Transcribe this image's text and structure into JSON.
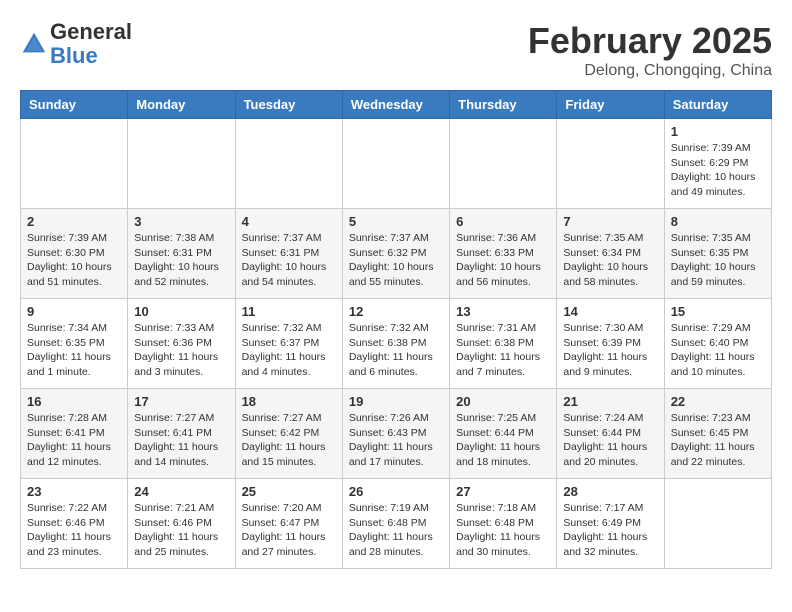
{
  "header": {
    "logo_line1": "General",
    "logo_line2": "Blue",
    "month": "February 2025",
    "location": "Delong, Chongqing, China"
  },
  "weekdays": [
    "Sunday",
    "Monday",
    "Tuesday",
    "Wednesday",
    "Thursday",
    "Friday",
    "Saturday"
  ],
  "weeks": [
    [
      {
        "day": "",
        "info": ""
      },
      {
        "day": "",
        "info": ""
      },
      {
        "day": "",
        "info": ""
      },
      {
        "day": "",
        "info": ""
      },
      {
        "day": "",
        "info": ""
      },
      {
        "day": "",
        "info": ""
      },
      {
        "day": "1",
        "info": "Sunrise: 7:39 AM\nSunset: 6:29 PM\nDaylight: 10 hours\nand 49 minutes."
      }
    ],
    [
      {
        "day": "2",
        "info": "Sunrise: 7:39 AM\nSunset: 6:30 PM\nDaylight: 10 hours\nand 51 minutes."
      },
      {
        "day": "3",
        "info": "Sunrise: 7:38 AM\nSunset: 6:31 PM\nDaylight: 10 hours\nand 52 minutes."
      },
      {
        "day": "4",
        "info": "Sunrise: 7:37 AM\nSunset: 6:31 PM\nDaylight: 10 hours\nand 54 minutes."
      },
      {
        "day": "5",
        "info": "Sunrise: 7:37 AM\nSunset: 6:32 PM\nDaylight: 10 hours\nand 55 minutes."
      },
      {
        "day": "6",
        "info": "Sunrise: 7:36 AM\nSunset: 6:33 PM\nDaylight: 10 hours\nand 56 minutes."
      },
      {
        "day": "7",
        "info": "Sunrise: 7:35 AM\nSunset: 6:34 PM\nDaylight: 10 hours\nand 58 minutes."
      },
      {
        "day": "8",
        "info": "Sunrise: 7:35 AM\nSunset: 6:35 PM\nDaylight: 10 hours\nand 59 minutes."
      }
    ],
    [
      {
        "day": "9",
        "info": "Sunrise: 7:34 AM\nSunset: 6:35 PM\nDaylight: 11 hours\nand 1 minute."
      },
      {
        "day": "10",
        "info": "Sunrise: 7:33 AM\nSunset: 6:36 PM\nDaylight: 11 hours\nand 3 minutes."
      },
      {
        "day": "11",
        "info": "Sunrise: 7:32 AM\nSunset: 6:37 PM\nDaylight: 11 hours\nand 4 minutes."
      },
      {
        "day": "12",
        "info": "Sunrise: 7:32 AM\nSunset: 6:38 PM\nDaylight: 11 hours\nand 6 minutes."
      },
      {
        "day": "13",
        "info": "Sunrise: 7:31 AM\nSunset: 6:38 PM\nDaylight: 11 hours\nand 7 minutes."
      },
      {
        "day": "14",
        "info": "Sunrise: 7:30 AM\nSunset: 6:39 PM\nDaylight: 11 hours\nand 9 minutes."
      },
      {
        "day": "15",
        "info": "Sunrise: 7:29 AM\nSunset: 6:40 PM\nDaylight: 11 hours\nand 10 minutes."
      }
    ],
    [
      {
        "day": "16",
        "info": "Sunrise: 7:28 AM\nSunset: 6:41 PM\nDaylight: 11 hours\nand 12 minutes."
      },
      {
        "day": "17",
        "info": "Sunrise: 7:27 AM\nSunset: 6:41 PM\nDaylight: 11 hours\nand 14 minutes."
      },
      {
        "day": "18",
        "info": "Sunrise: 7:27 AM\nSunset: 6:42 PM\nDaylight: 11 hours\nand 15 minutes."
      },
      {
        "day": "19",
        "info": "Sunrise: 7:26 AM\nSunset: 6:43 PM\nDaylight: 11 hours\nand 17 minutes."
      },
      {
        "day": "20",
        "info": "Sunrise: 7:25 AM\nSunset: 6:44 PM\nDaylight: 11 hours\nand 18 minutes."
      },
      {
        "day": "21",
        "info": "Sunrise: 7:24 AM\nSunset: 6:44 PM\nDaylight: 11 hours\nand 20 minutes."
      },
      {
        "day": "22",
        "info": "Sunrise: 7:23 AM\nSunset: 6:45 PM\nDaylight: 11 hours\nand 22 minutes."
      }
    ],
    [
      {
        "day": "23",
        "info": "Sunrise: 7:22 AM\nSunset: 6:46 PM\nDaylight: 11 hours\nand 23 minutes."
      },
      {
        "day": "24",
        "info": "Sunrise: 7:21 AM\nSunset: 6:46 PM\nDaylight: 11 hours\nand 25 minutes."
      },
      {
        "day": "25",
        "info": "Sunrise: 7:20 AM\nSunset: 6:47 PM\nDaylight: 11 hours\nand 27 minutes."
      },
      {
        "day": "26",
        "info": "Sunrise: 7:19 AM\nSunset: 6:48 PM\nDaylight: 11 hours\nand 28 minutes."
      },
      {
        "day": "27",
        "info": "Sunrise: 7:18 AM\nSunset: 6:48 PM\nDaylight: 11 hours\nand 30 minutes."
      },
      {
        "day": "28",
        "info": "Sunrise: 7:17 AM\nSunset: 6:49 PM\nDaylight: 11 hours\nand 32 minutes."
      },
      {
        "day": "",
        "info": ""
      }
    ]
  ]
}
